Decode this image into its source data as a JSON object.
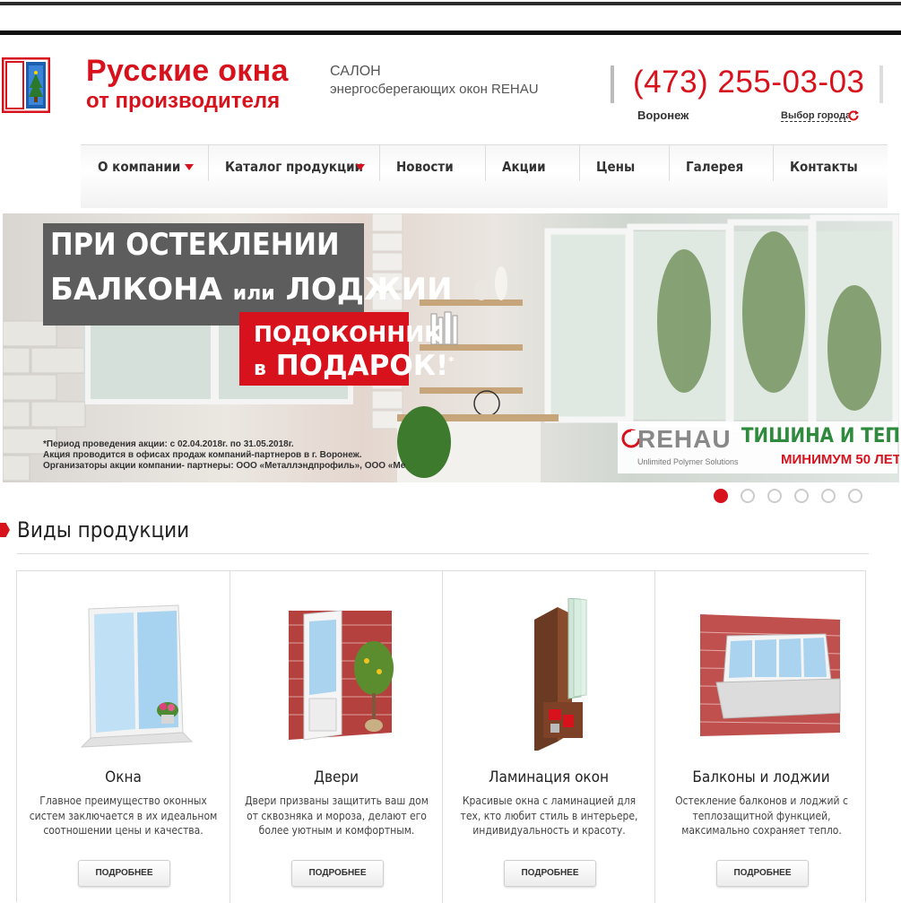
{
  "header": {
    "brand_line1": "Русские окна",
    "brand_line2": "от производителя",
    "salon_line1": "САЛОН",
    "salon_line2": "энергосберегающих окон REHAU",
    "phone": "(473) 255-03-03",
    "city": "Воронеж",
    "city_select": "Выбор города"
  },
  "nav": {
    "items": [
      {
        "label": "О компании",
        "dropdown": true
      },
      {
        "label": "Каталог продукции",
        "dropdown": true
      },
      {
        "label": "Новости",
        "dropdown": false
      },
      {
        "label": "Акции",
        "dropdown": false
      },
      {
        "label": "Цены",
        "dropdown": false
      },
      {
        "label": "Галерея",
        "dropdown": false
      },
      {
        "label": "Контакты",
        "dropdown": false
      }
    ]
  },
  "banner": {
    "headline_line1": "ПРИ ОСТЕКЛЕНИИ",
    "headline_line2a": "БАЛКОНА",
    "headline_line2b": "или",
    "headline_line2c": "ЛОДЖИИ",
    "promo_line1": "ПОДОКОННИК",
    "promo_line2a": "в",
    "promo_line2b": "ПОДАРОК!",
    "promo_star": "*",
    "note_line1": "*Период проведения акции: с 02.04.2018г. по 31.05.2018г.",
    "note_line2": "Акция проводится в офисах продаж компаний-партнеров в г. Воронеж.",
    "note_line3": "Организаторы акции компании- партнеры: ООО «Металлэндпрофиль», ООО «Ме",
    "rehau_logo": "REHAU",
    "rehau_sub": "Unlimited Polymer Solutions",
    "rehau_tag1": "ТИШИНА И ТЕПЛО",
    "rehau_tag2": "МИНИМУМ 50 ЛЕТ"
  },
  "slider": {
    "total": 6,
    "active": 1
  },
  "products": {
    "section_title": "Виды продукции",
    "button_label": "ПОДРОБНЕЕ",
    "items": [
      {
        "title": "Окна",
        "desc": "Главное преимущество оконных систем заключается в их идеальном соотношении цены и качества."
      },
      {
        "title": "Двери",
        "desc": "Двери призваны защитить ваш дом от сквозняка и мороза, делают его более уютным и комфортным."
      },
      {
        "title": "Ламинация окон",
        "desc": "Красивые окна с ламинацией для тех, кто любит стиль в интерьере, индивидуальность и красоту."
      },
      {
        "title": "Балконы и лоджии",
        "desc": "Остекление балконов и лоджий с теплозащитной функцией, максимально сохраняет тепло."
      }
    ]
  },
  "colors": {
    "accent": "#d8121c",
    "green": "#2e8a3c"
  }
}
